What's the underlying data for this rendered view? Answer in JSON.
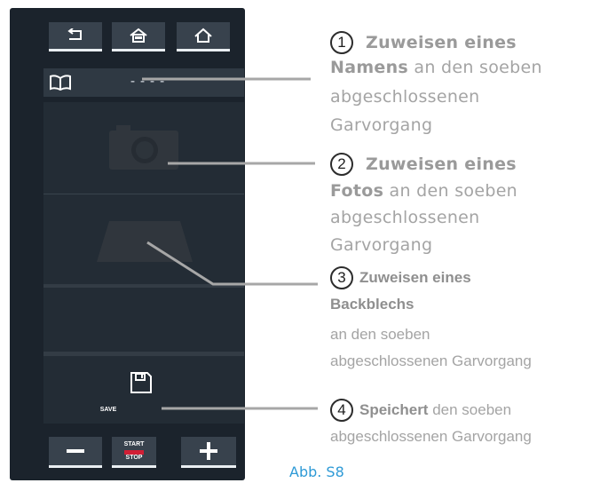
{
  "device": {
    "name_placeholder": "----",
    "save_label": "SAVE",
    "start_label": "START",
    "stop_label": "STOP",
    "accent_color": "#d01f35"
  },
  "callouts": [
    {
      "number": "1",
      "lead": "Zuweisen eines",
      "bold": "Namens",
      "rest1": " an den soeben",
      "rest2": "abgeschlossenen",
      "rest3": "Garvorgang"
    },
    {
      "number": "2",
      "lead": "Zuweisen eines",
      "bold": "Fotos",
      "rest1": " an den soeben",
      "rest2": "abgeschlossenen",
      "rest3": "Garvorgang"
    },
    {
      "number": "3",
      "lead": "Zuweisen eines",
      "bold": "Backblechs",
      "rest1": "an den soeben",
      "rest2": "abgeschlossenen Garvorgang"
    },
    {
      "number": "4",
      "bold": "Speichert",
      "rest1": " den soeben",
      "rest2": "abgeschlossenen Garvorgang"
    }
  ],
  "figure_label": "Abb. S8",
  "icons": [
    "back-icon",
    "my-home-icon",
    "home-icon",
    "book-icon",
    "camera-icon",
    "tray-icon",
    "save-disk-icon",
    "minus-icon",
    "plus-icon"
  ]
}
